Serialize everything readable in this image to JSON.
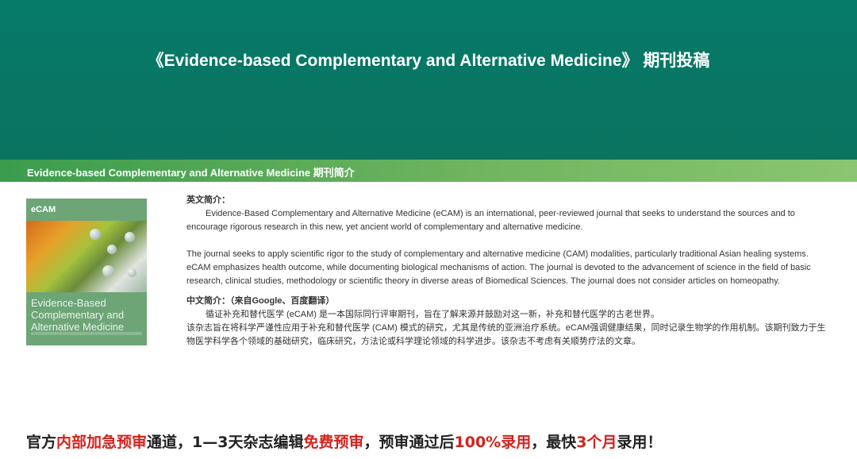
{
  "banner": {
    "title": "《Evidence-based Complementary and Alternative Medicine》 期刊投稿"
  },
  "intro": {
    "title": "Evidence-based Complementary and Alternative Medicine 期刊简介"
  },
  "cover": {
    "logo": "eCAM",
    "title_lines": [
      "Evidence-Based",
      "Complementary and",
      "Alternative Medicine"
    ]
  },
  "english": {
    "label": "英文简介：",
    "p1": "Evidence-Based Complementary and Alternative Medicine (eCAM) is an international, peer-reviewed journal that seeks to understand the sources and to encourage rigorous research in this new, yet ancient world of complementary and alternative medicine.",
    "p2": "The journal seeks to apply scientific rigor to the study of complementary and alternative medicine (CAM) modalities, particularly traditional Asian healing systems. eCAM emphasizes health outcome, while documenting biological mechanisms of action. The journal is devoted to the advancement of science in the field of basic research, clinical studies, methodology or scientific theory in diverse areas of Biomedical Sciences. The journal does not consider articles on homeopathy."
  },
  "chinese": {
    "label": "中文简介：（来自Google、百度翻译）",
    "p1": "循证补充和替代医学 (eCAM) 是一本国际同行评审期刊，旨在了解来源并鼓励对这一新，补充和替代医学的古老世界。",
    "p2": "该杂志旨在将科学严谨性应用于补充和替代医学 (CAM) 模式的研究，尤其是传统的亚洲治疗系统。eCAM强调健康结果，同时记录生物学的作用机制。该期刊致力于生物医学科学各个领域的基础研究，临床研究，方法论或科学理论领域的科学进步。该杂志不考虑有关顺势疗法的文章。"
  },
  "cta": {
    "part1": "官方",
    "red1": "内部加急预审",
    "part2": "通道，1—3天杂志编辑",
    "red2": "免费预审",
    "part3": "，预审通过后",
    "red3": "100%录用",
    "part4": "，最快",
    "red4": "3个月",
    "part5": "录用！"
  }
}
